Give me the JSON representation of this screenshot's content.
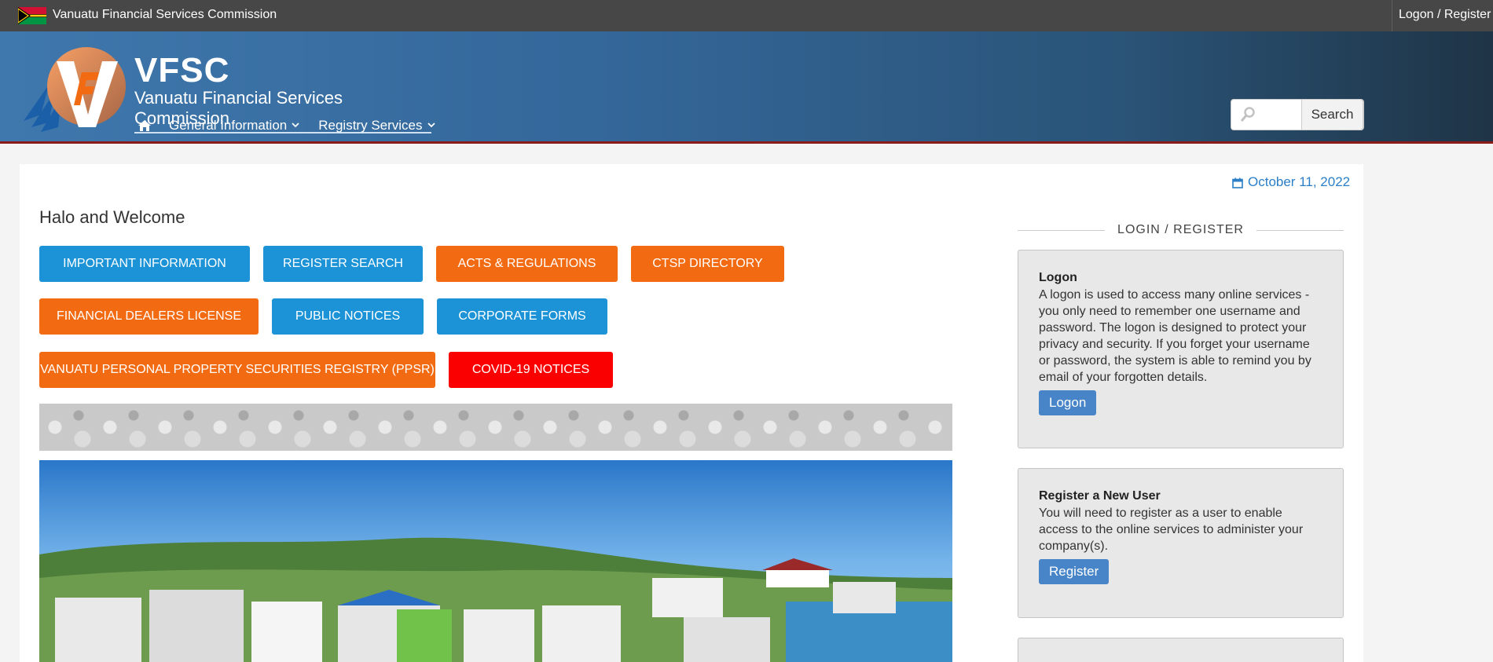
{
  "topbar": {
    "site_name": "Vanuatu Financial Services Commission",
    "logon_register": "Logon / Register"
  },
  "header": {
    "abbr": "VFSC",
    "full_name": "Vanuatu Financial Services Commission",
    "nav": {
      "general_information": "General Information",
      "registry_services": "Registry Services"
    },
    "search": {
      "placeholder": "",
      "button": "Search"
    }
  },
  "main": {
    "date": "October 11, 2022",
    "welcome": "Halo and Welcome",
    "buttons": {
      "important_information": "IMPORTANT INFORMATION",
      "register_search": "REGISTER SEARCH",
      "acts_regulations": "ACTS & REGULATIONS",
      "ctsp_directory": "CTSP DIRECTORY",
      "financial_dealers_license": "FINANCIAL DEALERS LICENSE",
      "public_notices": "PUBLIC NOTICES",
      "corporate_forms": "CORPORATE FORMS",
      "ppsr": "VANUATU PERSONAL PROPERTY SECURITIES REGISTRY (PPSR)",
      "covid_notices": "COVID-19 NOTICES"
    }
  },
  "sidebar": {
    "section_title": "LOGIN / REGISTER",
    "logon_panel": {
      "title": "Logon",
      "text": "A logon is used to access many online services - you only need to remember one username and password. The logon is designed to protect your privacy and security. If you forget your username or password, the system is able to remind you by email of your forgotten details.",
      "button": "Logon"
    },
    "register_panel": {
      "title": "Register a New User",
      "text": "You will need to register as a user to enable access to the online services to administer your company(s).",
      "button": "Register"
    }
  },
  "colors": {
    "accent_blue": "#1b93d6",
    "accent_orange": "#f26b12",
    "alert_red": "#fb0000",
    "header_blue": "#3f78ad",
    "link_blue": "#2a7fc7"
  },
  "icons": [
    "vanuatu-flag-icon",
    "vfsc-logo-icon",
    "home-icon",
    "chevron-down-icon",
    "search-icon",
    "calendar-icon"
  ]
}
